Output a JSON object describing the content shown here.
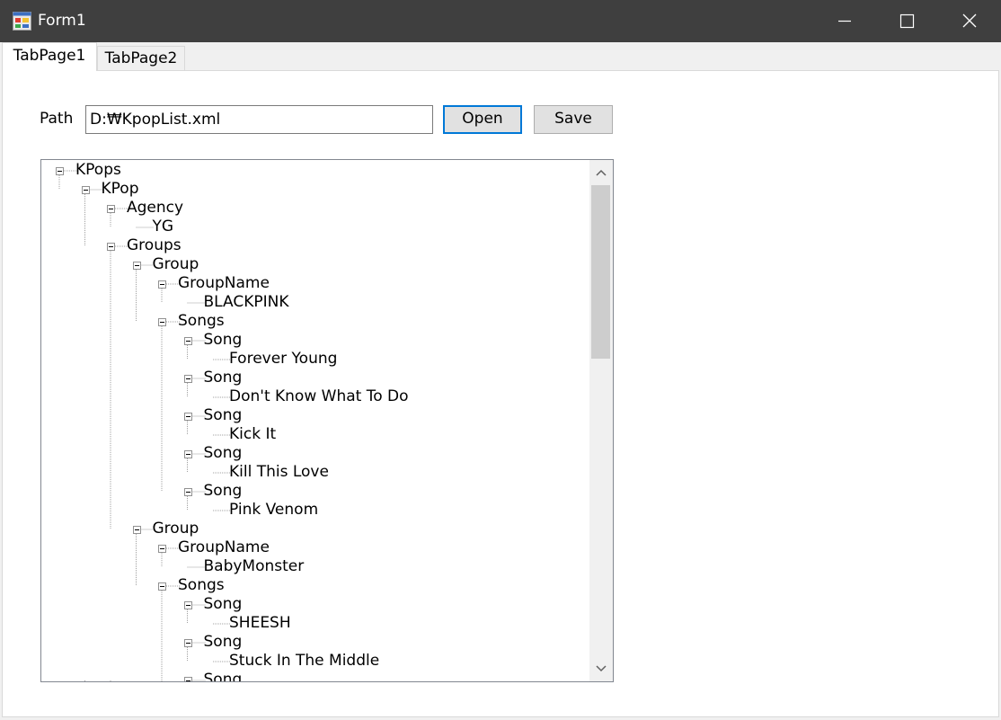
{
  "window": {
    "title": "Form1",
    "icons": {
      "app": "form-app-icon",
      "minimize": "minimize-icon",
      "maximize": "maximize-icon",
      "close": "close-icon"
    }
  },
  "tabs": [
    {
      "label": "TabPage1",
      "selected": true
    },
    {
      "label": "TabPage2",
      "selected": false
    }
  ],
  "path": {
    "label": "Path",
    "value": "D:₩KpopList.xml",
    "open_label": "Open",
    "save_label": "Save"
  },
  "tree": {
    "nodes": [
      {
        "label": "KPops",
        "expanded": true
      },
      {
        "label": "KPop",
        "expanded": true
      },
      {
        "label": "Agency",
        "expanded": true
      },
      {
        "label": "YG"
      },
      {
        "label": "Groups",
        "expanded": true
      },
      {
        "label": "Group",
        "expanded": true
      },
      {
        "label": "GroupName",
        "expanded": true
      },
      {
        "label": "BLACKPINK"
      },
      {
        "label": "Songs",
        "expanded": true
      },
      {
        "label": "Song",
        "expanded": true
      },
      {
        "label": "Forever Young"
      },
      {
        "label": "Song",
        "expanded": true
      },
      {
        "label": "Don't Know What To Do"
      },
      {
        "label": "Song",
        "expanded": true
      },
      {
        "label": "Kick It"
      },
      {
        "label": "Song",
        "expanded": true
      },
      {
        "label": "Kill This Love"
      },
      {
        "label": "Song",
        "expanded": true
      },
      {
        "label": "Pink Venom"
      },
      {
        "label": "Group",
        "expanded": true
      },
      {
        "label": "GroupName",
        "expanded": true
      },
      {
        "label": "BabyMonster"
      },
      {
        "label": "Songs",
        "expanded": true
      },
      {
        "label": "Song",
        "expanded": true
      },
      {
        "label": "SHEESH"
      },
      {
        "label": "Song",
        "expanded": true
      },
      {
        "label": "Stuck In The Middle"
      },
      {
        "label": "Song",
        "expanded": true
      }
    ],
    "scroll_icons": {
      "up": "chevron-up-icon",
      "down": "chevron-down-icon"
    }
  }
}
